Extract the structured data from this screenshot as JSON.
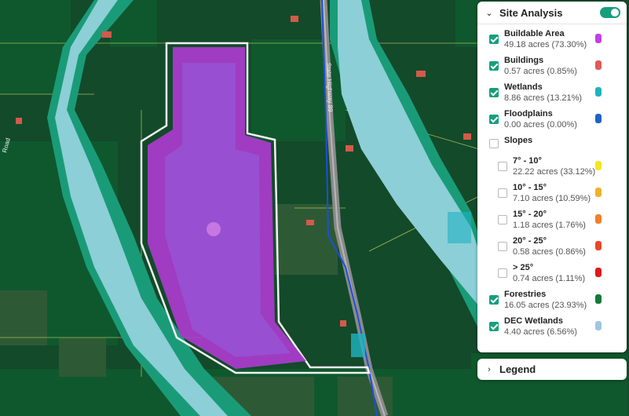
{
  "map": {
    "road_label": "State Highway 89",
    "edge_label": "Road"
  },
  "site_analysis": {
    "title": "Site Analysis",
    "collapse_icon": "chevron-down-icon",
    "toggle_on": true,
    "layers": [
      {
        "label": "Buildable Area",
        "detail": "49.18 acres (73.30%)",
        "checked": true,
        "color": "#c23fe8"
      },
      {
        "label": "Buildings",
        "detail": "0.57 acres (0.85%)",
        "checked": true,
        "color": "#e05a5a"
      },
      {
        "label": "Wetlands",
        "detail": "8.86 acres (13.21%)",
        "checked": true,
        "color": "#1fb3c0"
      },
      {
        "label": "Floodplains",
        "detail": "0.00 acres (0.00%)",
        "checked": true,
        "color": "#1e63c4"
      },
      {
        "label": "Slopes",
        "detail": "",
        "checked": false,
        "color": ""
      },
      {
        "label": "7° - 10°",
        "detail": "22.22 acres (33.12%)",
        "checked": false,
        "color": "#f3e726"
      },
      {
        "label": "10° - 15°",
        "detail": "7.10 acres (10.59%)",
        "checked": false,
        "color": "#f2b12c"
      },
      {
        "label": "15° - 20°",
        "detail": "1.18 acres (1.76%)",
        "checked": false,
        "color": "#f07f2a"
      },
      {
        "label": "20° - 25°",
        "detail": "0.58 acres (0.86%)",
        "checked": false,
        "color": "#e8462a"
      },
      {
        "label": "> 25°",
        "detail": "0.74 acres (1.11%)",
        "checked": false,
        "color": "#e01919"
      },
      {
        "label": "Forestries",
        "detail": "16.05 acres (23.93%)",
        "checked": true,
        "color": "#127a38"
      },
      {
        "label": "DEC Wetlands",
        "detail": "4.40 acres (6.56%)",
        "checked": true,
        "color": "#9fc6dd"
      }
    ]
  },
  "legend": {
    "title": "Legend",
    "expand_icon": "chevron-right-icon"
  }
}
